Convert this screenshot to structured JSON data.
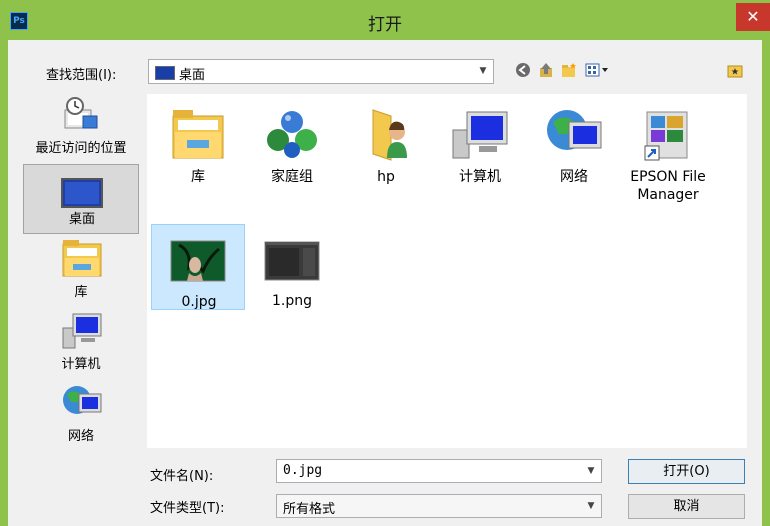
{
  "window": {
    "app_icon_text": "Ps",
    "title": "打开",
    "close_glyph": "✕"
  },
  "lookin": {
    "label": "查找范围(I):",
    "value": "桌面"
  },
  "toolbar": {
    "back_icon": "back-icon",
    "up_icon": "up-folder-icon",
    "new_folder_icon": "new-folder-icon",
    "view_icon": "view-menu-icon"
  },
  "sidebar": {
    "items": [
      {
        "label": "最近访问的位置",
        "icon": "recent-places-icon"
      },
      {
        "label": "桌面",
        "icon": "desktop-icon"
      },
      {
        "label": "库",
        "icon": "library-icon"
      },
      {
        "label": "计算机",
        "icon": "computer-icon"
      },
      {
        "label": "网络",
        "icon": "network-icon"
      }
    ]
  },
  "files": [
    {
      "label": "库"
    },
    {
      "label": "家庭组"
    },
    {
      "label": "hp"
    },
    {
      "label": "计算机"
    },
    {
      "label": "网络"
    },
    {
      "label": "EPSON File Manager"
    },
    {
      "label": "0.jpg"
    },
    {
      "label": "1.png"
    }
  ],
  "filename": {
    "label": "文件名(N):",
    "value": "0.jpg"
  },
  "filetype": {
    "label": "文件类型(T):",
    "value": "所有格式"
  },
  "buttons": {
    "open": "打开(O)",
    "cancel": "取消"
  },
  "colors": {
    "accent_select": "#cce8ff",
    "close_red": "#c7372c",
    "chrome_green": "#8fc24a"
  }
}
